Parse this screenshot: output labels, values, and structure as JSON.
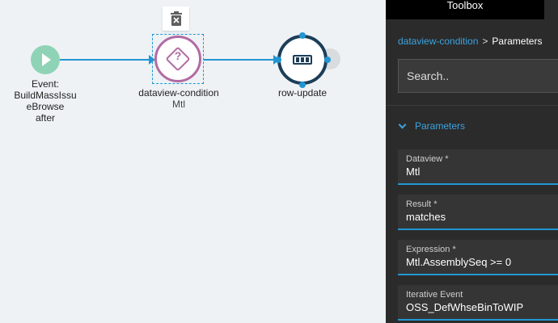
{
  "canvas": {
    "start_node": {
      "label_lines": [
        "Event:",
        "BuildMassIssu",
        "eBrowse",
        "after"
      ]
    },
    "condition_node": {
      "title": "dataview-condition",
      "subtitle": "Mtl"
    },
    "row_node": {
      "title": "row-update"
    }
  },
  "panel": {
    "tab": "Toolbox",
    "breadcrumb": {
      "link": "dataview-condition",
      "separator": ">",
      "current": "Parameters"
    },
    "search": {
      "placeholder": "Search.."
    },
    "section": {
      "title": "Parameters"
    },
    "fields": [
      {
        "label": "Dataview *",
        "value": "Mtl"
      },
      {
        "label": "Result *",
        "value": "matches"
      },
      {
        "label": "Expression *",
        "value": "Mtl.AssemblySeq >= 0"
      },
      {
        "label": "Iterative Event",
        "value": "OSS_DefWhseBinToWIP"
      }
    ]
  },
  "colors": {
    "accent": "#2196d3",
    "condition": "#b26ba3",
    "start": "#8fd3b6",
    "row": "#1c3e58",
    "panel_bg": "#2b2b2b"
  }
}
